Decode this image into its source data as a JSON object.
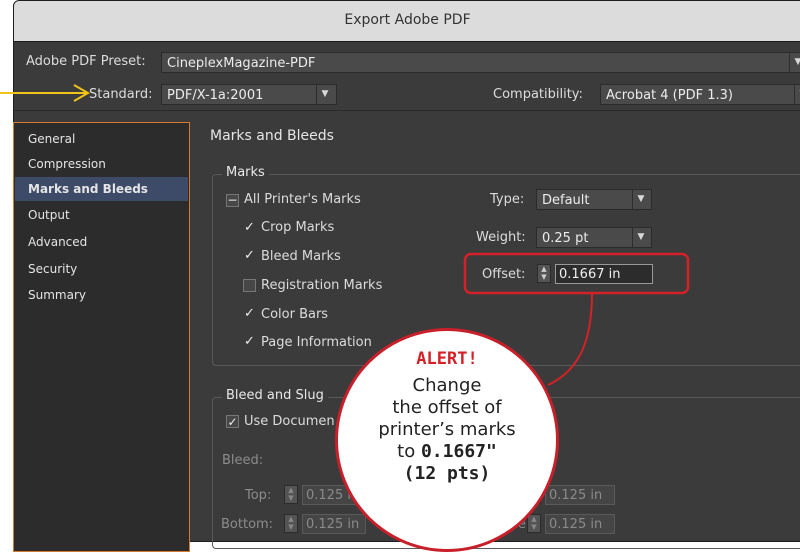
{
  "window": {
    "title": "Export Adobe PDF"
  },
  "preset": {
    "label": "Adobe PDF Preset:",
    "value": "CineplexMagazine-PDF"
  },
  "standard": {
    "label": "Standard:",
    "value": "PDF/X-1a:2001"
  },
  "compatibility": {
    "label": "Compatibility:",
    "value": "Acrobat 4 (PDF 1.3)"
  },
  "sidebar": {
    "items": [
      {
        "label": "General"
      },
      {
        "label": "Compression"
      },
      {
        "label": "Marks and Bleeds"
      },
      {
        "label": "Output"
      },
      {
        "label": "Advanced"
      },
      {
        "label": "Security"
      },
      {
        "label": "Summary"
      }
    ],
    "selected": "Marks and Bleeds"
  },
  "section_title": "Marks and Bleeds",
  "marks": {
    "group_title": "Marks",
    "all_printers_marks": "All Printer's Marks",
    "crop_marks": "Crop Marks",
    "bleed_marks": "Bleed Marks",
    "registration_marks": "Registration Marks",
    "color_bars": "Color Bars",
    "page_information": "Page Information",
    "type_label": "Type:",
    "type_value": "Default",
    "weight_label": "Weight:",
    "weight_value": "0.25 pt",
    "offset_label": "Offset:",
    "offset_value": "0.1667 in"
  },
  "bleed_slug": {
    "group_title": "Bleed and Slug",
    "use_document": "Use Documen",
    "bleed_label": "Bleed:",
    "top_label": "Top:",
    "top_value": "0.125 in",
    "bottom_label": "Bottom:",
    "bottom_value": "0.125 in",
    "right_top_value": "0.125 in",
    "right_bottom_label": "ide:",
    "right_bottom_value": "0.125 in"
  },
  "alert": {
    "heading": "ALERT!",
    "line1": "Change",
    "line2": "the offset of",
    "line3": "printer’s marks",
    "line4_prefix": "to ",
    "line4_value": "0.1667\"",
    "line5": "(12 pts)"
  },
  "colors": {
    "dialog_bg": "#3b3b3b",
    "accent_orange": "#d47a2a",
    "highlight_red": "#d42127",
    "arrow_yellow": "#f2c318",
    "selection_blue": "#3d4a68"
  }
}
